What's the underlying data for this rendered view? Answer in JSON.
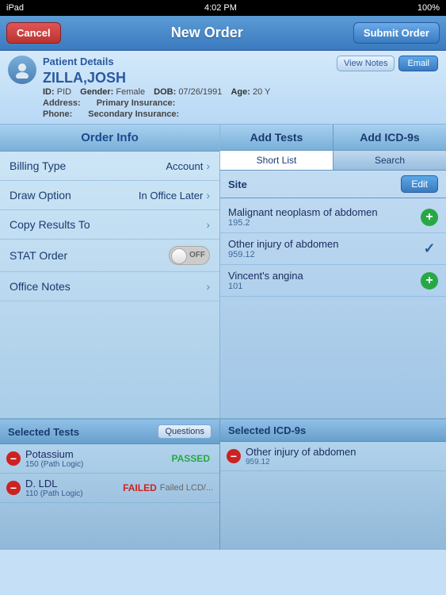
{
  "statusBar": {
    "carrier": "iPad",
    "time": "4:02 PM",
    "battery": "100%"
  },
  "navBar": {
    "cancelLabel": "Cancel",
    "title": "New Order",
    "submitLabel": "Submit Order"
  },
  "patient": {
    "sectionLabel": "Patient Details",
    "viewNotesLabel": "View Notes",
    "emailLabel": "Email",
    "name": "ZILLA,JOSH",
    "idLabel": "ID:",
    "idValue": "PID",
    "genderLabel": "Gender:",
    "genderValue": "Female",
    "dobLabel": "DOB:",
    "dobValue": "07/26/1991",
    "ageLabel": "Age:",
    "ageValue": "20 Y",
    "addressLabel": "Address:",
    "addressValue": "",
    "phoneLabel": "Phone:",
    "phoneValue": "",
    "primaryInsLabel": "Primary Insurance:",
    "primaryInsValue": "",
    "secondaryInsLabel": "Secondary Insurance:",
    "secondaryInsValue": ""
  },
  "orderInfo": {
    "title": "Order Info",
    "billingLabel": "Billing Type",
    "billingValue": "Account",
    "drawLabel": "Draw Option",
    "drawValue": "In Office Later",
    "copyResultsLabel": "Copy Results To",
    "copyResultsValue": "",
    "statOrderLabel": "STAT Order",
    "statValue": "OFF",
    "officeNotesLabel": "Office Notes"
  },
  "addTests": {
    "addTestsLabel": "Add Tests",
    "addIcdLabel": "Add ICD-9s",
    "shortListLabel": "Short List",
    "searchLabel": "Search",
    "siteLabel": "Site",
    "editLabel": "Edit",
    "icdItems": [
      {
        "name": "Malignant neoplasm of abdomen",
        "code": "195.2",
        "action": "add"
      },
      {
        "name": "Other injury of abdomen",
        "code": "959.12",
        "action": "check"
      },
      {
        "name": "Vincent's angina",
        "code": "101",
        "action": "add"
      }
    ]
  },
  "selectedTests": {
    "title": "Selected Tests",
    "questionsLabel": "Questions",
    "items": [
      {
        "name": "Potassium",
        "sub": "150 (Path Logic)",
        "status": "PASSED",
        "statusType": "passed"
      },
      {
        "name": "D. LDL",
        "sub": "110 (Path Logic)",
        "status": "FAILED",
        "statusExtra": "Failed LCD/...",
        "statusType": "failed"
      }
    ]
  },
  "selectedIcds": {
    "title": "Selected ICD-9s",
    "items": [
      {
        "name": "Other injury of abdomen",
        "code": "959.12"
      }
    ]
  }
}
